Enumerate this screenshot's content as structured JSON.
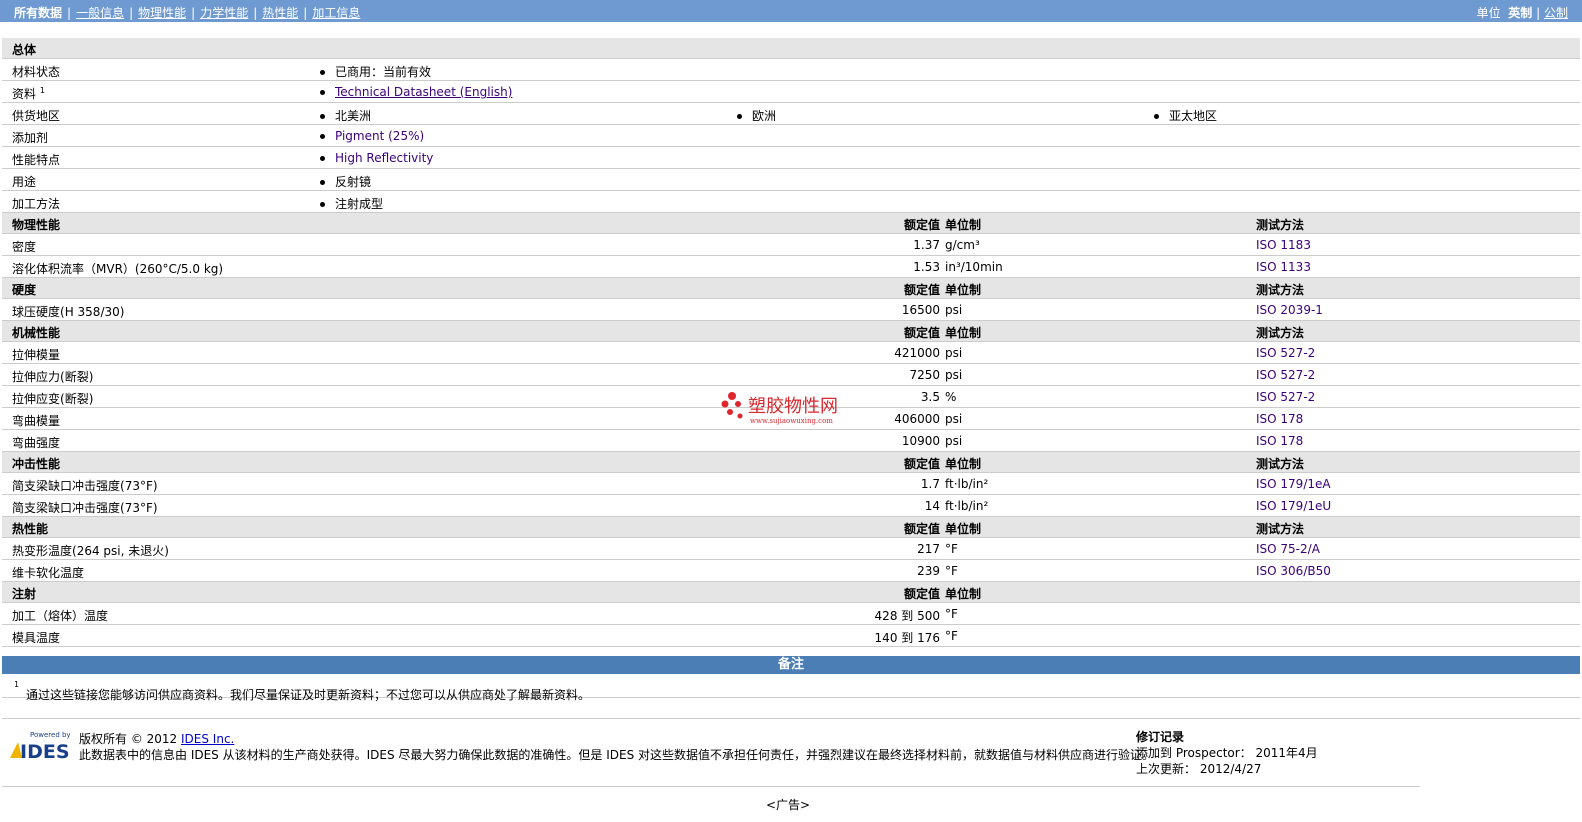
{
  "nav": {
    "items": [
      "所有数据",
      "一般信息",
      "物理性能",
      "力学性能",
      "热性能",
      "加工信息"
    ],
    "unit_label": "单位",
    "unit_options": [
      "英制",
      "公制"
    ]
  },
  "columns": {
    "nominal": "额定值",
    "unit": "单位制",
    "method": "测试方法"
  },
  "general": {
    "title": "总体",
    "rows": [
      {
        "name": "材料状态",
        "values": [
          "已商用：当前有效"
        ]
      },
      {
        "name": "资料",
        "sup": "1",
        "values": [
          "Technical Datasheet (English)"
        ]
      },
      {
        "name": "供货地区",
        "values": [
          "北美洲",
          "欧洲",
          "亚太地区"
        ]
      },
      {
        "name": "添加剂",
        "values": [
          "Pigment (25%)"
        ]
      },
      {
        "name": "性能特点",
        "values": [
          "High Reflectivity"
        ]
      },
      {
        "name": "用途",
        "values": [
          "反射镜"
        ]
      },
      {
        "name": "加工方法",
        "values": [
          "注射成型"
        ]
      }
    ]
  },
  "sections": [
    {
      "title": "物理性能",
      "has_method": true,
      "rows": [
        {
          "name": "密度",
          "cond": "",
          "value": "1.37",
          "unit": "g/cm³",
          "method": "ISO 1183"
        },
        {
          "name": "溶化体积流率（MVR）",
          "cond": "(260°C/5.0 kg)",
          "value": "1.53",
          "unit": "in³/10min",
          "method": "ISO 1133"
        }
      ]
    },
    {
      "title": "硬度",
      "has_method": true,
      "rows": [
        {
          "name": "球压硬度",
          "cond": "(H 358/30)",
          "value": "16500",
          "unit": "psi",
          "method": "ISO 2039-1"
        }
      ]
    },
    {
      "title": "机械性能",
      "has_method": true,
      "rows": [
        {
          "name": "拉伸模量",
          "cond": "",
          "value": "421000",
          "unit": "psi",
          "method": "ISO 527-2"
        },
        {
          "name": "拉伸应力",
          "cond": "(断裂)",
          "value": "7250",
          "unit": "psi",
          "method": "ISO 527-2"
        },
        {
          "name": "拉伸应变",
          "cond": "(断裂)",
          "value": "3.5",
          "unit": "%",
          "method": "ISO 527-2"
        },
        {
          "name": "弯曲模量",
          "cond": "",
          "value": "406000",
          "unit": "psi",
          "method": "ISO 178"
        },
        {
          "name": "弯曲强度",
          "cond": "",
          "value": "10900",
          "unit": "psi",
          "method": "ISO 178"
        }
      ]
    },
    {
      "title": "冲击性能",
      "has_method": true,
      "rows": [
        {
          "name": "简支梁缺口冲击强度",
          "cond": "(73°F)",
          "value": "1.7",
          "unit": "ft·lb/in²",
          "method": "ISO 179/1eA"
        },
        {
          "name": "简支梁缺口冲击强度",
          "cond": "(73°F)",
          "value": "14",
          "unit": "ft·lb/in²",
          "method": "ISO 179/1eU"
        }
      ]
    },
    {
      "title": "热性能",
      "has_method": true,
      "rows": [
        {
          "name": "热变形温度",
          "cond": "(264 psi, 未退火)",
          "value": "217",
          "unit": "°F",
          "method": "ISO 75-2/A"
        },
        {
          "name": "维卡软化温度",
          "cond": "",
          "value": "239",
          "unit": "°F",
          "method": "ISO 306/B50"
        }
      ]
    },
    {
      "title": "注射",
      "has_method": false,
      "rows": [
        {
          "name": "加工（熔体）温度",
          "cond": "",
          "value": "428 到  500",
          "unit": "°F",
          "method": ""
        },
        {
          "name": "模具温度",
          "cond": "",
          "value": "140 到  176",
          "unit": "°F",
          "method": ""
        }
      ]
    }
  ],
  "notes": {
    "title": "备注",
    "items": [
      {
        "sup": "1",
        "text": "通过这些链接您能够访问供应商资料。我们尽量保证及时更新资料；不过您可以从供应商处了解最新资料。"
      }
    ]
  },
  "footer": {
    "logo_top": "Powered by",
    "logo_text": "IDES",
    "copyright": "版权所有 © 2012",
    "company_link": "IDES Inc.",
    "disclaimer": "此数据表中的信息由 IDES 从该材料的生产商处获得。IDES 尽最大努力确保此数据的准确性。但是 IDES 对这些数据值不承担任何责任，并强烈建议在最终选择材料前，就数据值与材料供应商进行验证。",
    "revision_title": "修订记录",
    "added": "添加到 Prospector：  2011年4月",
    "updated": "上次更新：  2012/4/27",
    "ad": "<广告>"
  },
  "watermark": {
    "text": "塑胶物性网",
    "url": "www.sujiaowuxing.com"
  },
  "colors": {
    "topbar": "#6f9ad1",
    "notes_bar": "#4a7eb5",
    "header_row": "#e5e5e5",
    "link": "#3a007a"
  }
}
